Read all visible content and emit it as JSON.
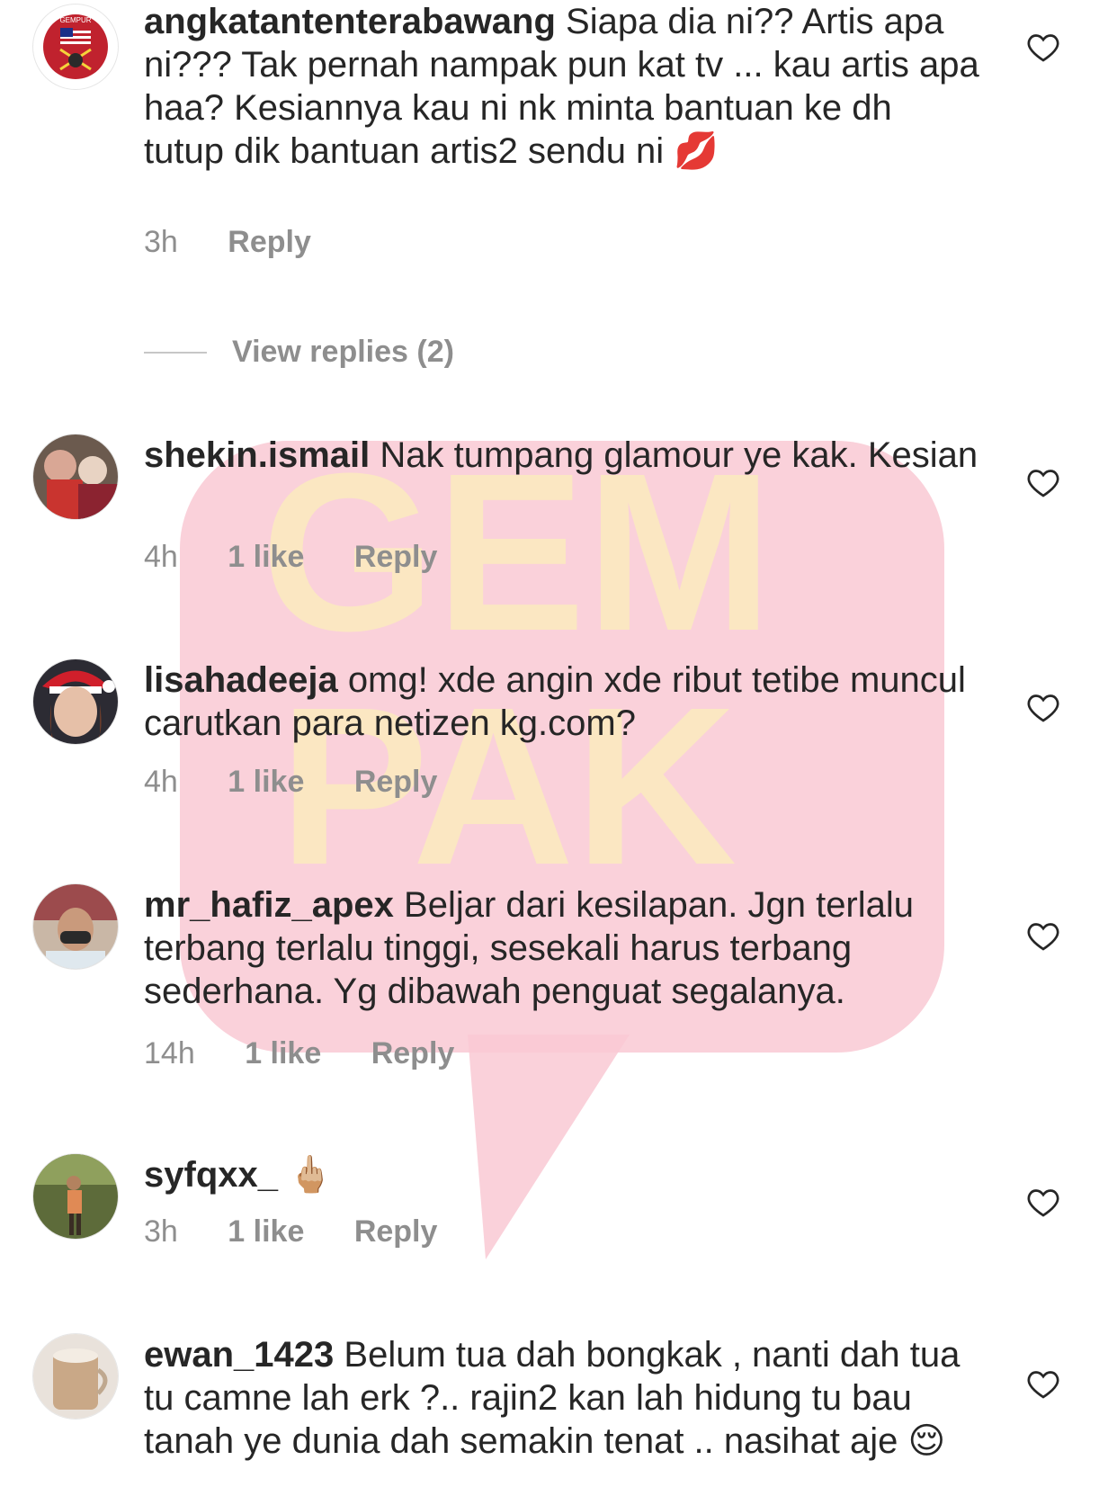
{
  "watermark": {
    "line1": "GEM",
    "line2": "PAK"
  },
  "colors": {
    "watermark_bubble": "#f9c9d4",
    "watermark_text": "#fbe7c2",
    "meta": "#8e8e8e",
    "text": "#262626"
  },
  "comments": [
    {
      "username": "angkatantenterabawang",
      "text": "Siapa dia ni?? Artis apa ni??? Tak pernah nampak pun kat tv ... kau artis apa haa? Kesiannya kau ni nk minta bantuan ke dh tutup dik bantuan artis2 sendu ni",
      "emoji": "💋",
      "time": "3h",
      "likes": "",
      "reply": "Reply"
    },
    {
      "username": "shekin.ismail",
      "text": "Nak tumpang glamour ye kak. Kesian",
      "emoji": "",
      "time": "4h",
      "likes": "1 like",
      "reply": "Reply"
    },
    {
      "username": "lisahadeeja",
      "text": "omg! xde angin xde ribut tetibe muncul carutkan para netizen kg.com?",
      "emoji": "",
      "time": "4h",
      "likes": "1 like",
      "reply": "Reply"
    },
    {
      "username": "mr_hafiz_apex",
      "text": "Beljar dari kesilapan. Jgn terlalu terbang terlalu tinggi, sesekali harus terbang sederhana. Yg dibawah penguat segalanya.",
      "emoji": "",
      "time": "14h",
      "likes": "1 like",
      "reply": "Reply"
    },
    {
      "username": "syfqxx_",
      "text": "",
      "emoji": "🖕🏼",
      "time": "3h",
      "likes": "1 like",
      "reply": "Reply"
    },
    {
      "username": "ewan_1423",
      "text": "Belum tua dah bongkak , nanti dah tua tu camne lah erk ?.. rajin2 kan lah hidung tu bau tanah ye dunia dah semakin tenat .. nasihat aje",
      "emoji": "😌",
      "time": "",
      "likes": "",
      "reply": ""
    }
  ],
  "view_replies": "View replies (2)",
  "avatar_labels": {
    "first": "GEMPUR"
  },
  "icons": {
    "like": "heart-outline-icon"
  }
}
